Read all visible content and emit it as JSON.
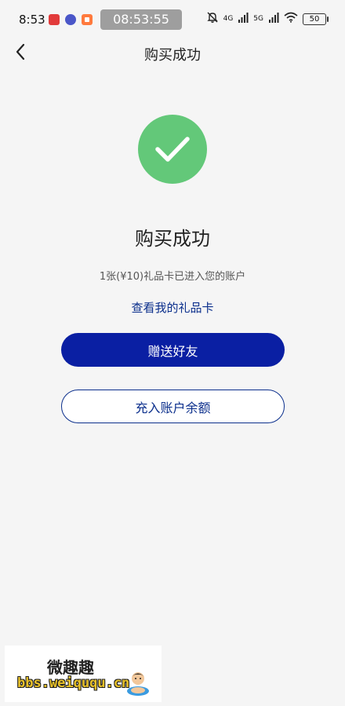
{
  "status_bar": {
    "time": "8:53",
    "clock_pill": "08:53:55",
    "network_1": "4G",
    "network_2": "5G",
    "battery": "50",
    "icons": [
      "notification-app-icon",
      "notification-app-icon",
      "notification-app-icon",
      "mute-icon",
      "signal-icon",
      "signal-icon",
      "wifi-icon",
      "battery-icon"
    ]
  },
  "header": {
    "title": "购买成功",
    "back_icon": "chevron-left-icon"
  },
  "success": {
    "icon": "checkmark-icon",
    "icon_color": "#63c879",
    "heading": "购买成功",
    "message": "1张(¥10)礼品卡已进入您的账户",
    "view_link": "查看我的礼品卡"
  },
  "actions": {
    "primary_label": "赠送好友",
    "secondary_label": "充入账户余额",
    "accent_color": "#0a1fa3"
  },
  "watermark": {
    "line1": "微趣趣",
    "line2": "bbs.weiququ.cn"
  }
}
